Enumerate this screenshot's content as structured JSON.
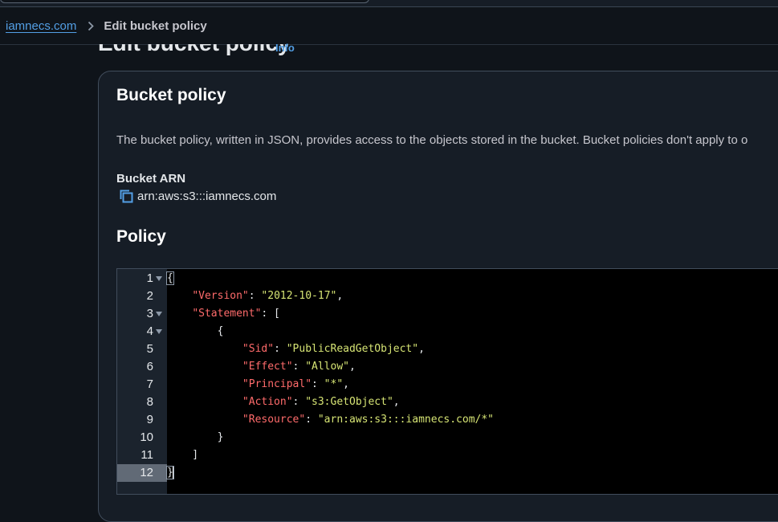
{
  "breadcrumb": {
    "bucket_link": "iamnecs.com",
    "current": "Edit bucket policy"
  },
  "page": {
    "title": "Edit bucket policy",
    "info_link": "Info"
  },
  "panel": {
    "title": "Bucket policy",
    "description": "The bucket policy, written in JSON, provides access to the objects stored in the bucket. Bucket policies don't apply to o",
    "arn_label": "Bucket ARN",
    "arn_value": "arn:aws:s3:::iamnecs.com",
    "policy_label": "Policy"
  },
  "editor": {
    "active_line": 12,
    "lines": [
      {
        "n": "1",
        "fold": true,
        "tokens": [
          {
            "t": "{",
            "c": "p"
          }
        ]
      },
      {
        "n": "2",
        "fold": false,
        "tokens": [
          {
            "t": "    ",
            "c": "p"
          },
          {
            "t": "\"Version\"",
            "c": "k"
          },
          {
            "t": ": ",
            "c": "p"
          },
          {
            "t": "\"2012-10-17\"",
            "c": "s"
          },
          {
            "t": ",",
            "c": "p"
          }
        ]
      },
      {
        "n": "3",
        "fold": true,
        "tokens": [
          {
            "t": "    ",
            "c": "p"
          },
          {
            "t": "\"Statement\"",
            "c": "k"
          },
          {
            "t": ": [",
            "c": "p"
          }
        ]
      },
      {
        "n": "4",
        "fold": true,
        "tokens": [
          {
            "t": "        {",
            "c": "p"
          }
        ]
      },
      {
        "n": "5",
        "fold": false,
        "tokens": [
          {
            "t": "            ",
            "c": "p"
          },
          {
            "t": "\"Sid\"",
            "c": "k"
          },
          {
            "t": ": ",
            "c": "p"
          },
          {
            "t": "\"PublicReadGetObject\"",
            "c": "s"
          },
          {
            "t": ",",
            "c": "p"
          }
        ]
      },
      {
        "n": "6",
        "fold": false,
        "tokens": [
          {
            "t": "            ",
            "c": "p"
          },
          {
            "t": "\"Effect\"",
            "c": "k"
          },
          {
            "t": ": ",
            "c": "p"
          },
          {
            "t": "\"Allow\"",
            "c": "s"
          },
          {
            "t": ",",
            "c": "p"
          }
        ]
      },
      {
        "n": "7",
        "fold": false,
        "tokens": [
          {
            "t": "            ",
            "c": "p"
          },
          {
            "t": "\"Principal\"",
            "c": "k"
          },
          {
            "t": ": ",
            "c": "p"
          },
          {
            "t": "\"*\"",
            "c": "s"
          },
          {
            "t": ",",
            "c": "p"
          }
        ]
      },
      {
        "n": "8",
        "fold": false,
        "tokens": [
          {
            "t": "            ",
            "c": "p"
          },
          {
            "t": "\"Action\"",
            "c": "k"
          },
          {
            "t": ": ",
            "c": "p"
          },
          {
            "t": "\"s3:GetObject\"",
            "c": "s"
          },
          {
            "t": ",",
            "c": "p"
          }
        ]
      },
      {
        "n": "9",
        "fold": false,
        "tokens": [
          {
            "t": "            ",
            "c": "p"
          },
          {
            "t": "\"Resource\"",
            "c": "k"
          },
          {
            "t": ": ",
            "c": "p"
          },
          {
            "t": "\"arn:aws:s3:::iamnecs.com/*\"",
            "c": "s"
          }
        ]
      },
      {
        "n": "10",
        "fold": false,
        "tokens": [
          {
            "t": "        }",
            "c": "p"
          }
        ]
      },
      {
        "n": "11",
        "fold": false,
        "tokens": [
          {
            "t": "    ]",
            "c": "p"
          }
        ]
      },
      {
        "n": "12",
        "fold": false,
        "tokens": [
          {
            "t": "}",
            "c": "p"
          }
        ]
      }
    ]
  },
  "colors": {
    "link": "#539fe5",
    "json_key": "#ff6b6b",
    "json_string": "#d6e474",
    "editor_bg": "#000000"
  }
}
